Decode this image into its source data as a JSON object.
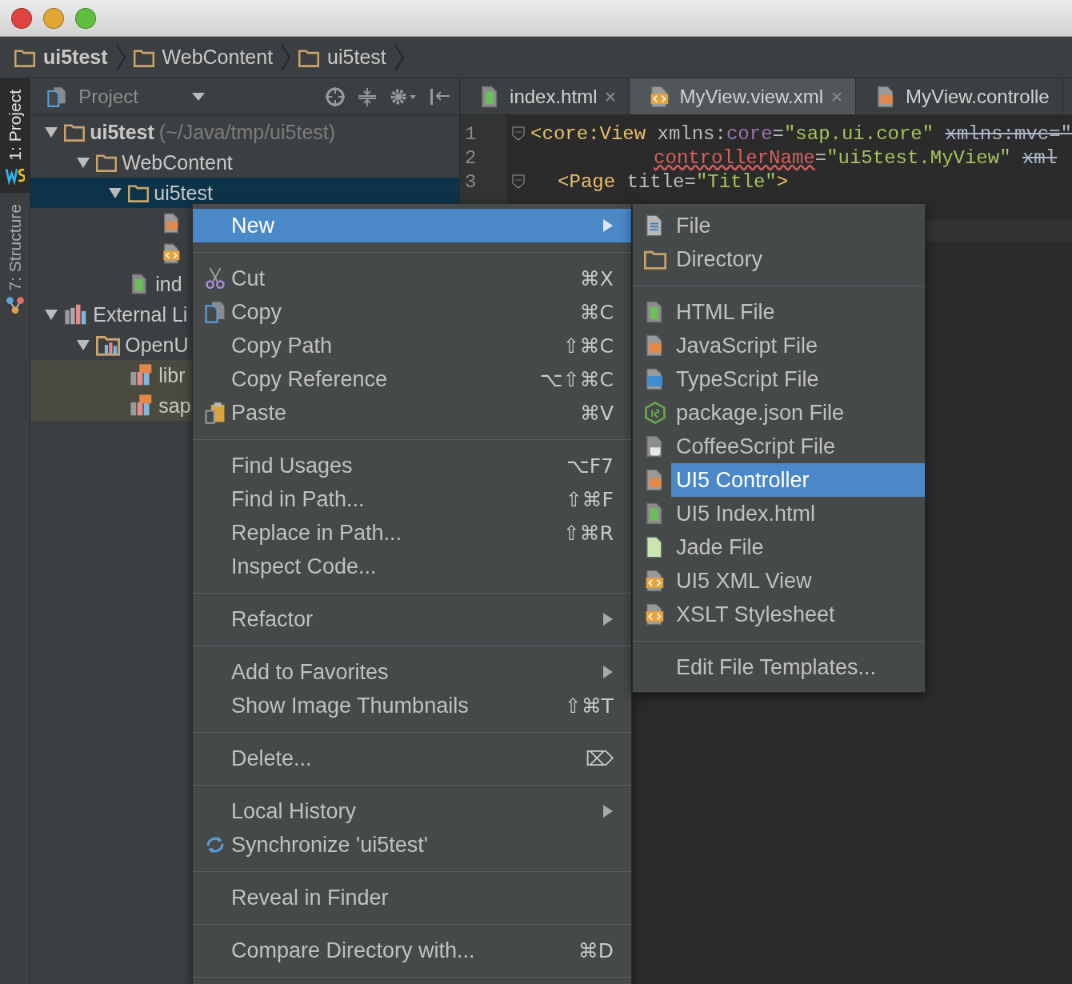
{
  "window": {
    "kind": "mac"
  },
  "breadcrumbs": [
    "ui5test",
    "WebContent",
    "ui5test"
  ],
  "tool_stripe": [
    {
      "label": "1: Project",
      "selected": true,
      "kind": "ws"
    },
    {
      "label": "7: Structure",
      "selected": false,
      "kind": "structure"
    }
  ],
  "project_panel": {
    "title": "Project",
    "tree": [
      {
        "label": "ui5test",
        "path": "(~/Java/tmp/ui5test)",
        "kind": "folder",
        "expanded": true,
        "selected": false,
        "children": [
          {
            "label": "WebContent",
            "kind": "folder",
            "expanded": true,
            "selected": false,
            "children": [
              {
                "label": "ui5test",
                "kind": "folder",
                "expanded": true,
                "selected": true,
                "children": [
                  {
                    "kind": "js",
                    "selected": false
                  },
                  {
                    "kind": "xml",
                    "selected": false
                  }
                ]
              },
              {
                "label": "ind",
                "kind": "html",
                "selected": false
              }
            ]
          }
        ]
      },
      {
        "label": "External Li",
        "kind": "lib",
        "expanded": true,
        "selected": false,
        "children": [
          {
            "label": "OpenU",
            "kind": "libfolder",
            "expanded": true,
            "selected": false,
            "children": [
              {
                "label": "libr",
                "kind": "jslib",
                "selected": false,
                "highlighted": true
              },
              {
                "label": "sap",
                "kind": "jslib",
                "selected": false,
                "highlighted": true
              }
            ]
          }
        ]
      }
    ]
  },
  "tabs": [
    {
      "label": "index.html",
      "kind": "html",
      "selected": false,
      "closable": true
    },
    {
      "label": "MyView.view.xml",
      "kind": "xml",
      "selected": true,
      "closable": true
    },
    {
      "label": "MyView.controlle",
      "kind": "js",
      "selected": false,
      "closable": false
    }
  ],
  "editor": {
    "lines": [
      {
        "number": "1",
        "kind": "top",
        "fold": true,
        "segments": [
          {
            "text": "<core:View",
            "kind": "tag"
          },
          {
            "text": "xmlns:",
            "kind": "attr",
            "space": true
          },
          {
            "text": "core",
            "kind": "ns"
          },
          {
            "text": "=",
            "kind": "attr"
          },
          {
            "text": "\"sap.ui.core\"",
            "kind": "value"
          },
          {
            "text": "xmlns:mvc=\"",
            "kind": "struck",
            "space": true
          }
        ]
      },
      {
        "number": "2",
        "kind": "continuation",
        "fold": false,
        "segments": [
          {
            "text": "controllerName",
            "kind": "error"
          },
          {
            "text": "=",
            "kind": "attr"
          },
          {
            "text": "\"ui5test.MyView\"",
            "kind": "value"
          },
          {
            "text": "xml",
            "kind": "struck",
            "space": true
          }
        ]
      },
      {
        "number": "3",
        "kind": "nested",
        "fold": true,
        "segments": [
          {
            "text": "<Page",
            "kind": "tag"
          },
          {
            "text": "title=",
            "kind": "attr",
            "space": true
          },
          {
            "text": "\"Title\"",
            "kind": "value"
          },
          {
            "text": ">",
            "kind": "tag"
          }
        ]
      }
    ]
  },
  "context_menu": [
    {
      "kind": "plain",
      "label": "New",
      "selected": true,
      "submenu": true
    },
    {
      "kind": "separator"
    },
    {
      "kind": "cut",
      "label": "Cut",
      "shortcut": "⌘X",
      "selected": false
    },
    {
      "kind": "copy",
      "label": "Copy",
      "shortcut": "⌘C",
      "selected": false
    },
    {
      "kind": "plain",
      "label": "Copy Path",
      "shortcut": "⇧⌘C",
      "selected": false
    },
    {
      "kind": "plain",
      "label": "Copy Reference",
      "shortcut": "⌥⇧⌘C",
      "selected": false
    },
    {
      "kind": "paste",
      "label": "Paste",
      "shortcut": "⌘V",
      "selected": false
    },
    {
      "kind": "separator"
    },
    {
      "kind": "plain",
      "label": "Find Usages",
      "shortcut": "⌥F7",
      "selected": false
    },
    {
      "kind": "plain",
      "label": "Find in Path...",
      "shortcut": "⇧⌘F",
      "selected": false
    },
    {
      "kind": "plain",
      "label": "Replace in Path...",
      "shortcut": "⇧⌘R",
      "selected": false
    },
    {
      "kind": "plain",
      "label": "Inspect Code...",
      "selected": false
    },
    {
      "kind": "separator"
    },
    {
      "kind": "plain",
      "label": "Refactor",
      "submenu": true,
      "selected": false
    },
    {
      "kind": "separator"
    },
    {
      "kind": "plain",
      "label": "Add to Favorites",
      "submenu": true,
      "selected": false
    },
    {
      "kind": "plain",
      "label": "Show Image Thumbnails",
      "shortcut": "⇧⌘T",
      "selected": false
    },
    {
      "kind": "separator"
    },
    {
      "kind": "plain",
      "label": "Delete...",
      "shortcut": "⌦",
      "selected": false
    },
    {
      "kind": "separator"
    },
    {
      "kind": "plain",
      "label": "Local History",
      "submenu": true,
      "selected": false
    },
    {
      "kind": "sync",
      "label": "Synchronize 'ui5test'",
      "selected": false
    },
    {
      "kind": "separator"
    },
    {
      "kind": "plain",
      "label": "Reveal in Finder",
      "selected": false
    },
    {
      "kind": "separator"
    },
    {
      "kind": "plain",
      "label": "Compare Directory with...",
      "shortcut": "⌘D",
      "selected": false
    },
    {
      "kind": "separator"
    }
  ],
  "new_submenu": [
    {
      "kind": "file",
      "label": "File",
      "selected": false
    },
    {
      "kind": "folder",
      "label": "Directory",
      "selected": false
    },
    {
      "kind": "separator"
    },
    {
      "kind": "html",
      "label": "HTML File",
      "selected": false
    },
    {
      "kind": "js",
      "label": "JavaScript File",
      "selected": false
    },
    {
      "kind": "ts",
      "label": "TypeScript File",
      "selected": false
    },
    {
      "kind": "node",
      "label": "package.json File",
      "selected": false
    },
    {
      "kind": "coffee",
      "label": "CoffeeScript File",
      "selected": false
    },
    {
      "kind": "js",
      "label": "UI5 Controller",
      "selected": true
    },
    {
      "kind": "html",
      "label": "UI5 Index.html",
      "selected": false
    },
    {
      "kind": "jade",
      "label": "Jade File",
      "selected": false
    },
    {
      "kind": "xml",
      "label": "UI5 XML View",
      "selected": false
    },
    {
      "kind": "xml",
      "label": "XSLT Stylesheet",
      "selected": false
    },
    {
      "kind": "separator"
    },
    {
      "kind": "plain",
      "label": "Edit File Templates...",
      "selected": false
    }
  ]
}
